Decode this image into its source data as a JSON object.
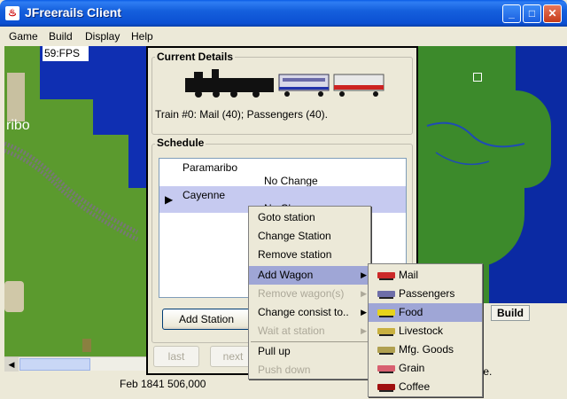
{
  "window": {
    "title": "JFreerails Client",
    "minimize_label": "_",
    "maximize_label": "□",
    "close_label": "✕"
  },
  "menubar": {
    "items": [
      "Game",
      "Build",
      "Display",
      "Help"
    ]
  },
  "map": {
    "fps_label": "59:FPS",
    "city_label": "ribo"
  },
  "status": {
    "date_money": "Feb 1841 506,000"
  },
  "right_panel": {
    "tab_build": "Build",
    "file_text": "ile."
  },
  "train_dialog": {
    "current_details_title": "Current Details",
    "train_info": "Train #0: Mail (40); Passengers (40).",
    "schedule_title": "Schedule",
    "schedule": [
      {
        "station": "Paramaribo",
        "change": "No Change"
      },
      {
        "station": "Cayenne",
        "change": "No Change"
      }
    ],
    "add_station_label": "Add Station",
    "last_label": "last",
    "next_label": "next"
  },
  "context_menu": {
    "items": [
      {
        "label": "Goto station",
        "enabled": true
      },
      {
        "label": "Change Station",
        "enabled": true
      },
      {
        "label": "Remove station",
        "enabled": true
      },
      {
        "label": "Add Wagon",
        "enabled": true,
        "submenu": true,
        "selected": true
      },
      {
        "label": "Remove wagon(s)",
        "enabled": false,
        "submenu": true
      },
      {
        "label": "Change consist to..",
        "enabled": true,
        "submenu": true
      },
      {
        "label": "Wait at station",
        "enabled": false,
        "submenu": true
      },
      {
        "label": "Pull up",
        "enabled": true
      },
      {
        "label": "Push down",
        "enabled": false
      }
    ]
  },
  "wagon_menu": {
    "items": [
      {
        "label": "Mail",
        "color": "#cc2a2a"
      },
      {
        "label": "Passengers",
        "color": "#6e6ea8"
      },
      {
        "label": "Food",
        "color": "#e6d21c"
      },
      {
        "label": "Livestock",
        "color": "#c8b040"
      },
      {
        "label": "Mfg. Goods",
        "color": "#b0a050"
      },
      {
        "label": "Grain",
        "color": "#d86070"
      },
      {
        "label": "Coffee",
        "color": "#a01010"
      }
    ],
    "selected_index": 2
  }
}
